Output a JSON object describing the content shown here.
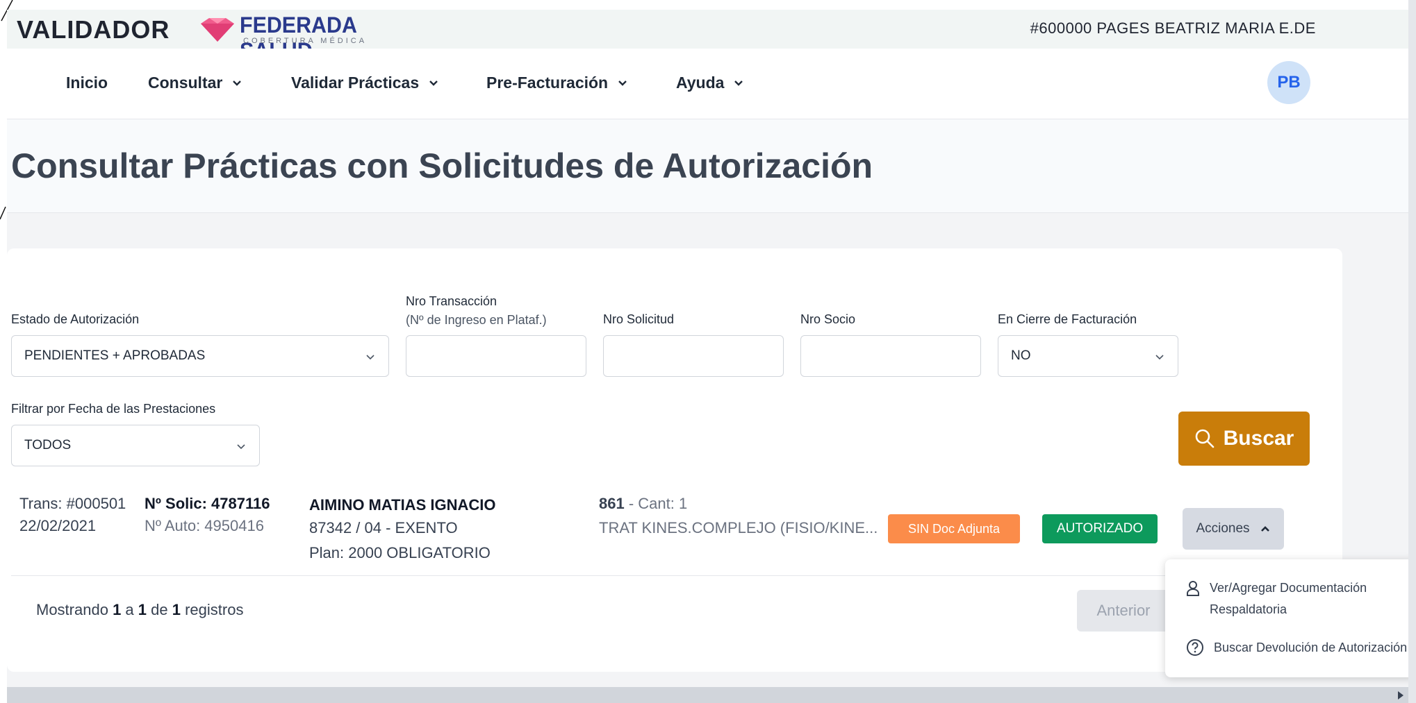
{
  "app": {
    "title": "VALIDADOR",
    "logo_name": "FEDERADA SALUD",
    "logo_sub": "COBERTURA MÉDICA",
    "user_id": "#600000 PAGES BEATRIZ MARIA E.DE",
    "avatar": "PB",
    "brand_color": "#2a3a8c",
    "accent_color": "#c97d0a"
  },
  "nav": {
    "inicio": "Inicio",
    "consultar": "Consultar",
    "validar": "Validar Prácticas",
    "prefact": "Pre-Facturación",
    "ayuda": "Ayuda"
  },
  "page": {
    "title": "Consultar Prácticas con Solicitudes de Autorización"
  },
  "filters": {
    "estado_label": "Estado de Autorización",
    "estado_value": "PENDIENTES + APROBADAS",
    "trans_label": "Nro Transacción",
    "trans_sub": "(Nº de Ingreso en Plataf.)",
    "trans_value": "",
    "solicitud_label": "Nro Solicitud",
    "solicitud_value": "",
    "socio_label": "Nro Socio",
    "socio_value": "",
    "cierre_label": "En Cierre de Facturación",
    "cierre_value": "NO",
    "fecha_label": "Filtrar por Fecha de las Prestaciones",
    "fecha_value": "TODOS",
    "buscar_label": "Buscar"
  },
  "results": {
    "rows": [
      {
        "trans": "Trans: #000501",
        "date": "22/02/2021",
        "solic": "Nº Solic: 4787116",
        "auto": "Nº Auto: 4950416",
        "name": "AIMINO MATIAS IGNACIO",
        "member": "87342 / 04 - EXENTO",
        "plan": "Plan: 2000 OBLIGATORIO",
        "code": "861",
        "cant": " - Cant: 1",
        "practice": "TRAT KINES.COMPLEJO (FISIO/KINE...",
        "badge_doc": "SIN Doc Adjunta",
        "badge_status": "AUTORIZADO",
        "actions_label": "Acciones"
      }
    ],
    "showing_prefix": "Mostrando ",
    "showing_from": "1",
    "showing_mid1": " a ",
    "showing_to": "1",
    "showing_mid2": " de ",
    "showing_total": "1",
    "showing_suffix": " registros",
    "prev_label": "Anterior"
  },
  "actions_menu": {
    "item1_line1": "Ver/Agregar Documentación",
    "item1_line2": "Respaldatoria",
    "item1_icon": "user-icon",
    "item2": "Buscar Devolución de Autorización",
    "item2_icon": "help-circle-icon"
  }
}
